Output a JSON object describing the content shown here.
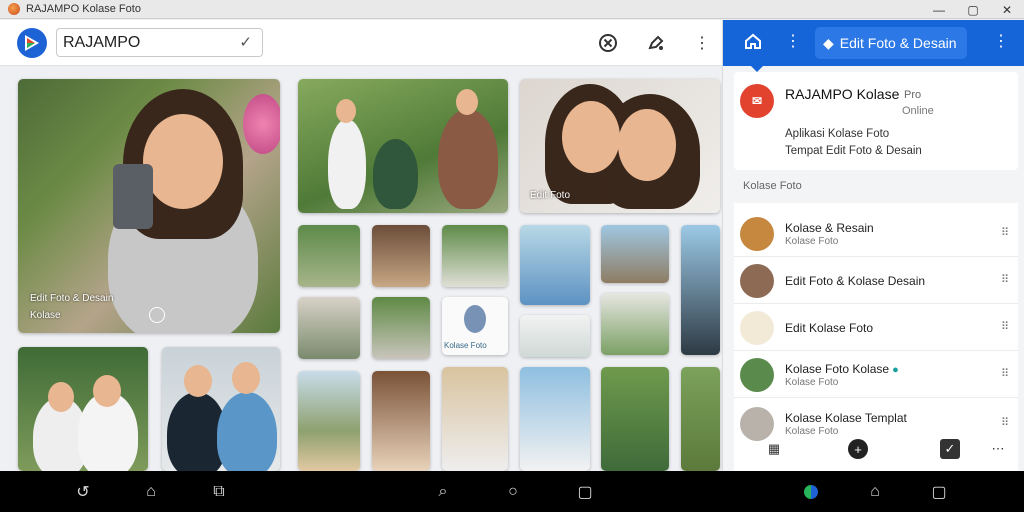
{
  "window": {
    "title": "RAJAMPO Kolase Foto"
  },
  "search": {
    "value": "RAJAMPO"
  },
  "left_caption": {
    "line1": "Edit Foto & Desain",
    "line2": "Kolase"
  },
  "grid_captions": {
    "top_right": "Edit Foto",
    "middle_small": "Kolase Foto"
  },
  "panel": {
    "header_label": "Edit Foto & Desain",
    "card": {
      "name": "RAJAMPO Kolase",
      "badge": "Pro",
      "status": "Online",
      "line1": "Aplikasi Kolase Foto",
      "line2": "Tempat Edit Foto & Desain"
    },
    "section_label": "Kolase Foto",
    "items": [
      {
        "title": "Kolase & Resain",
        "sub": "Kolase Foto",
        "color": "#c6873f"
      },
      {
        "title": "Edit Foto & Kolase Desain",
        "sub": "",
        "color": "#8c6a54"
      },
      {
        "title": "Edit Kolase Foto",
        "sub": "",
        "color": "#f2ead7"
      },
      {
        "title": "Kolase Foto Kolase",
        "sub": "Kolase Foto",
        "color": "#5a8a4c"
      },
      {
        "title": "Kolase Kolase Templat",
        "sub": "Kolase Foto",
        "color": "#b9b2ab"
      }
    ]
  },
  "icons": {
    "topbar": [
      "dropdown-chevron-icon",
      "close-circle-icon",
      "edit-icon",
      "more-vertical-icon"
    ],
    "panel_header": [
      "home-icon",
      "more-vertical-icon",
      "more-vertical-icon"
    ],
    "navbar": [
      "back-icon",
      "home-icon",
      "recents-icon",
      "back-icon",
      "home-icon",
      "recents-icon",
      "app-icon",
      "home-icon",
      "recents-icon"
    ]
  },
  "colors": {
    "accent": "#1565d8",
    "logo": "#1e63d6",
    "avatar": "#e2432e"
  }
}
